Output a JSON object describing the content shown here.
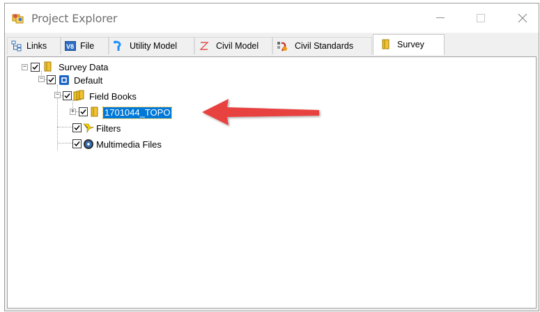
{
  "window": {
    "title": "Project Explorer",
    "controls": {
      "minimize": "minimize",
      "maximize": "maximize",
      "close": "close"
    }
  },
  "tabs": [
    {
      "label": "Links",
      "icon": "links-icon"
    },
    {
      "label": "File",
      "icon": "file-icon"
    },
    {
      "label": "Utility Model",
      "icon": "utility-model-icon"
    },
    {
      "label": "Civil Model",
      "icon": "civil-model-icon"
    },
    {
      "label": "Civil Standards",
      "icon": "civil-standards-icon"
    },
    {
      "label": "Survey",
      "icon": "survey-icon",
      "active": true
    }
  ],
  "tree": [
    {
      "label": "Survey Data",
      "expander": "−",
      "checked": true,
      "icon": "survey-data-icon"
    },
    {
      "label": "Default",
      "expander": "−",
      "checked": true,
      "icon": "default-project-icon"
    },
    {
      "label": "Field Books",
      "expander": "−",
      "checked": true,
      "icon": "field-books-icon"
    },
    {
      "label": "1701044_TOPO",
      "expander": "+",
      "checked": true,
      "icon": "field-book-icon",
      "selected": true
    },
    {
      "label": "Filters",
      "checked": true,
      "icon": "filter-icon"
    },
    {
      "label": "Multimedia Files",
      "checked": true,
      "icon": "multimedia-icon"
    }
  ],
  "annotation": {
    "type": "arrow",
    "color": "#e8423f",
    "points_to": "1701044_TOPO"
  },
  "colors": {
    "selection": "#0078d7",
    "window_bg": "#f0f0f0",
    "panel_bg": "#ffffff"
  }
}
